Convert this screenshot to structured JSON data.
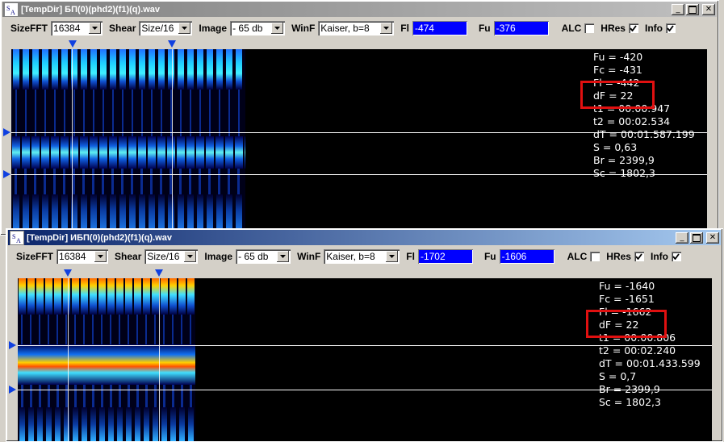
{
  "windows": [
    {
      "title": "[TempDir] БП(0)(phd2)(f1)(q).wav",
      "toolbar": {
        "sizefft_label": "SizeFFT",
        "sizefft_value": "16384",
        "shear_label": "Shear",
        "shear_value": "Size/16",
        "image_label": "Image",
        "image_value": "- 65 db",
        "winf_label": "WinF",
        "winf_value": "Kaiser, b=8",
        "fl_label": "Fl",
        "fl_value": "-474",
        "fu_label": "Fu",
        "fu_value": "-376",
        "alc_label": "ALC",
        "hres_label": "HRes",
        "info_label": "Info"
      },
      "checks": {
        "alc": false,
        "hres": true,
        "info": true
      },
      "info_lines": [
        "Fu = -420",
        "Fc = -431",
        "Fl = -442",
        "dF = 22",
        "t1 = 00:00.947",
        "t2 = 00:02.534",
        "dT = 00:01.587.199",
        "S = 0,63",
        "Br = 2399,9",
        "Sc = 1802,3"
      ]
    },
    {
      "title": "[TempDir] ИБП(0)(phd2)(f1)(q).wav",
      "toolbar": {
        "sizefft_label": "SizeFFT",
        "sizefft_value": "16384",
        "shear_label": "Shear",
        "shear_value": "Size/16",
        "image_label": "Image",
        "image_value": "- 65 db",
        "winf_label": "WinF",
        "winf_value": "Kaiser, b=8",
        "fl_label": "Fl",
        "fl_value": "-1702",
        "fu_label": "Fu",
        "fu_value": "-1606",
        "alc_label": "ALC",
        "hres_label": "HRes",
        "info_label": "Info"
      },
      "checks": {
        "alc": false,
        "hres": true,
        "info": true
      },
      "info_lines": [
        "Fu = -1640",
        "Fc = -1651",
        "Fl = -1662",
        "dF = 22",
        "t1 = 00:00.806",
        "t2 = 00:02.240",
        "dT = 00:01.433.599",
        "S = 0,7",
        "Br = 2399,9",
        "Sc = 1802,3"
      ]
    }
  ],
  "colors": {
    "highlight": "#e01010",
    "marker": "#1040e0",
    "numbox": "#0000ff"
  },
  "icons": {
    "window_app": "spectrum-analyzer-icon",
    "minimize": "minimize-icon",
    "maximize": "maximize-icon",
    "close": "close-icon"
  }
}
